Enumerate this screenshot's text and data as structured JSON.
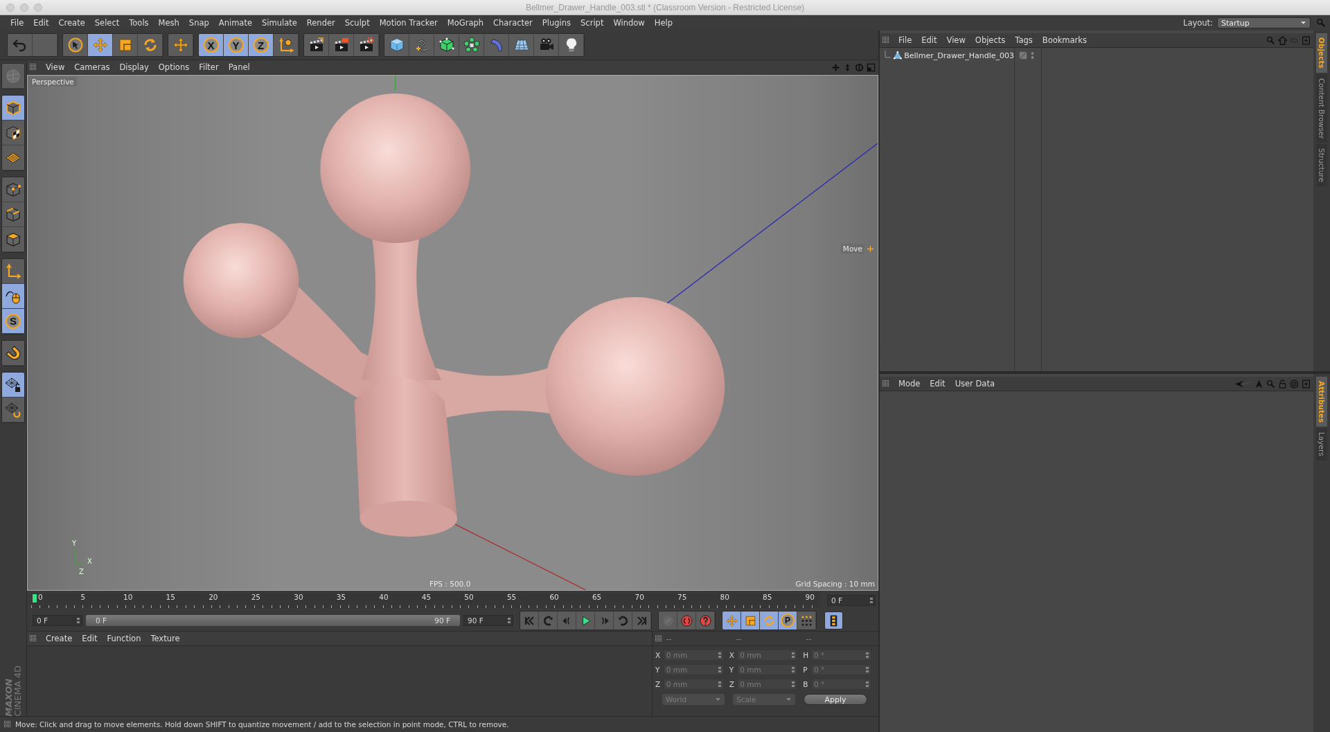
{
  "window": {
    "title": "Bellmer_Drawer_Handle_003.stl * (Classroom Version - Restricted License)"
  },
  "menu": [
    "File",
    "Edit",
    "Create",
    "Select",
    "Tools",
    "Mesh",
    "Snap",
    "Animate",
    "Simulate",
    "Render",
    "Sculpt",
    "Motion Tracker",
    "MoGraph",
    "Character",
    "Plugins",
    "Script",
    "Window",
    "Help"
  ],
  "layout": {
    "label": "Layout:",
    "value": "Startup"
  },
  "toolbar": [
    [
      {
        "kind": "undo",
        "selected": false
      },
      {
        "kind": "blank",
        "selected": false
      }
    ],
    [
      {
        "kind": "select",
        "selected": false
      },
      {
        "kind": "move",
        "selected": true
      },
      {
        "kind": "scale",
        "selected": false
      },
      {
        "kind": "rotate",
        "selected": false
      }
    ],
    [
      {
        "kind": "move",
        "selected": false
      }
    ],
    [
      {
        "kind": "letter",
        "label": "X",
        "selected": true
      },
      {
        "kind": "letter",
        "label": "Y",
        "selected": true
      },
      {
        "kind": "letter",
        "label": "Z",
        "selected": true
      },
      {
        "kind": "coord",
        "selected": false
      }
    ],
    [
      {
        "kind": "render-view",
        "selected": false
      },
      {
        "kind": "render-picture",
        "selected": false
      },
      {
        "kind": "render-settings",
        "selected": false
      }
    ],
    [
      {
        "kind": "cube",
        "selected": false
      },
      {
        "kind": "pen",
        "selected": false
      },
      {
        "kind": "subdiv",
        "selected": false
      },
      {
        "kind": "cloner",
        "selected": false
      },
      {
        "kind": "deformer",
        "selected": false
      },
      {
        "kind": "floor",
        "selected": false
      },
      {
        "kind": "camera",
        "selected": false
      },
      {
        "kind": "light",
        "selected": false
      }
    ]
  ],
  "left_tools": [
    [
      {
        "kind": "sculpt",
        "selected": false
      }
    ],
    [
      {
        "kind": "model",
        "selected": true
      },
      {
        "kind": "texture",
        "selected": false
      },
      {
        "kind": "workplane",
        "selected": false
      }
    ],
    [
      {
        "kind": "points",
        "selected": false
      },
      {
        "kind": "edges",
        "selected": false
      },
      {
        "kind": "polygons",
        "selected": false
      }
    ],
    [
      {
        "kind": "axis",
        "selected": false
      },
      {
        "kind": "tweak",
        "selected": true
      },
      {
        "kind": "letter",
        "label": "S",
        "selected": true
      }
    ],
    [
      {
        "kind": "magnet",
        "selected": false
      }
    ],
    [
      {
        "kind": "plane-lock",
        "selected": true
      },
      {
        "kind": "plane-snap",
        "selected": false
      }
    ]
  ],
  "logo": {
    "brand": "MAXON",
    "product": "CINEMA 4D"
  },
  "viewport": {
    "menu": [
      "View",
      "Cameras",
      "Display",
      "Options",
      "Filter",
      "Panel"
    ],
    "camera": "Perspective",
    "tool_hint": "Move",
    "fps": "FPS : 500.0",
    "grid": "Grid Spacing : 10 mm",
    "gizmo": [
      "Y",
      "X",
      "Z"
    ]
  },
  "timeline": {
    "ticks": [
      "0",
      "5",
      "10",
      "15",
      "20",
      "25",
      "30",
      "35",
      "40",
      "45",
      "50",
      "55",
      "60",
      "65",
      "70",
      "75",
      "80",
      "85",
      "90"
    ],
    "frame": "0 F"
  },
  "range": {
    "start": "0 F",
    "slider_start": "0 F",
    "slider_end": "90 F",
    "end": "90 F",
    "level": 1
  },
  "playback": [
    {
      "kind": "first"
    },
    {
      "kind": "prev-key"
    },
    {
      "kind": "prev-frame"
    },
    {
      "kind": "play"
    },
    {
      "kind": "next-frame"
    },
    {
      "kind": "next-key"
    },
    {
      "kind": "last"
    }
  ],
  "keys": [
    {
      "kind": "key-off",
      "selected": false
    },
    {
      "kind": "record",
      "selected": false
    },
    {
      "kind": "autokey",
      "selected": false
    }
  ],
  "tracks": [
    {
      "kind": "move",
      "selected": true
    },
    {
      "kind": "scale",
      "selected": true
    },
    {
      "kind": "rotate",
      "selected": true
    },
    {
      "kind": "letter",
      "label": "P",
      "selected": true
    },
    {
      "kind": "dots",
      "selected": false
    }
  ],
  "timeline_button": {
    "selected": true
  },
  "materials": {
    "menu": [
      "Create",
      "Edit",
      "Function",
      "Texture"
    ]
  },
  "coordinates": {
    "headers": [
      "--",
      "--",
      "--"
    ],
    "rows": [
      {
        "axis": "X",
        "position": "0 mm",
        "size_axis": "X",
        "size": "0 mm",
        "rot_axis": "H",
        "rotation": "0 °"
      },
      {
        "axis": "Y",
        "position": "0 mm",
        "size_axis": "Y",
        "size": "0 mm",
        "rot_axis": "P",
        "rotation": "0 °"
      },
      {
        "axis": "Z",
        "position": "0 mm",
        "size_axis": "Z",
        "size": "0 mm",
        "rot_axis": "B",
        "rotation": "0 °"
      }
    ],
    "space": "World",
    "mode": "Scale",
    "apply": "Apply"
  },
  "status": "Move: Click and drag to move elements. Hold down SHIFT to quantize movement / add to the selection in point mode, CTRL to remove.",
  "objects": {
    "menu": [
      "File",
      "Edit",
      "View",
      "Objects",
      "Tags",
      "Bookmarks"
    ],
    "items": [
      {
        "name": "Bellmer_Drawer_Handle_003"
      }
    ]
  },
  "attributes": {
    "menu": [
      "Mode",
      "Edit",
      "User Data"
    ]
  },
  "side_tabs_top": [
    {
      "label": "Objects",
      "selected": true
    },
    {
      "label": "Content Browser",
      "selected": false
    },
    {
      "label": "Structure",
      "selected": false
    }
  ],
  "side_tabs_bottom": [
    {
      "label": "Attributes",
      "selected": true
    },
    {
      "label": "Layers",
      "selected": false
    }
  ]
}
